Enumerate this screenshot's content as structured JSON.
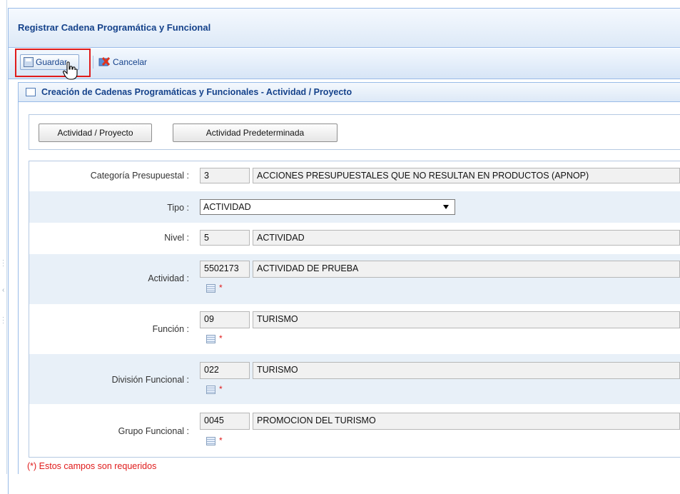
{
  "window": {
    "title": "Registrar Cadena Programática y Funcional"
  },
  "toolbar": {
    "save_label": "Guardar",
    "cancel_label": "Cancelar"
  },
  "panel": {
    "title": "Creación de Cadenas Programáticas y Funcionales - Actividad / Proyecto"
  },
  "buttons": {
    "actividad_proyecto": "Actividad / Proyecto",
    "actividad_predeterminada": "Actividad Predeterminada"
  },
  "form": {
    "categoria": {
      "label": "Categoría Presupuestal :",
      "code": "3",
      "desc": "ACCIONES PRESUPUESTALES QUE NO RESULTAN EN PRODUCTOS (APNOP)"
    },
    "tipo": {
      "label": "Tipo :",
      "selected": "ACTIVIDAD"
    },
    "nivel": {
      "label": "Nivel :",
      "code": "5",
      "desc": "ACTIVIDAD"
    },
    "actividad": {
      "label": "Actividad :",
      "code": "5502173",
      "desc": "ACTIVIDAD DE PRUEBA"
    },
    "funcion": {
      "label": "Función :",
      "code": "09",
      "desc": "TURISMO"
    },
    "division": {
      "label": "División Funcional :",
      "code": "022",
      "desc": "TURISMO"
    },
    "grupo": {
      "label": "Grupo Funcional :",
      "code": "0045",
      "desc": "PROMOCION DEL TURISMO"
    },
    "required_mark": "*"
  },
  "footer_note": "(*) Estos campos son requeridos",
  "colors": {
    "accent": "#15428b",
    "highlight": "#e01b1b",
    "row_alt": "#e8f0f8"
  }
}
